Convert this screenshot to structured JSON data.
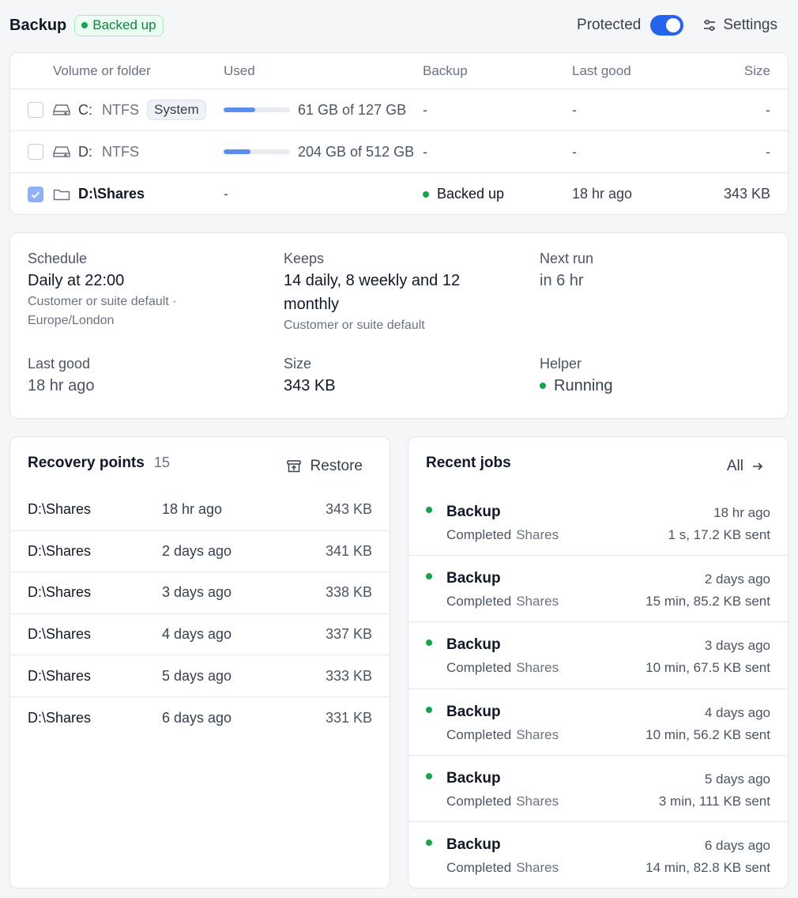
{
  "header": {
    "title": "Backup",
    "status_badge": "Backed up",
    "protected_label": "Protected",
    "protected_on": true,
    "settings_label": "Settings"
  },
  "volumes": {
    "columns": [
      "Volume or folder",
      "Used",
      "Backup",
      "Last good",
      "Size"
    ],
    "rows": [
      {
        "checked": false,
        "icon": "drive-icon",
        "name": "C:",
        "fs": "NTFS",
        "tag": "System",
        "used_fraction": 0.48,
        "used": "61 GB of 127 GB",
        "backup": "-",
        "last_good": "-",
        "size": "-"
      },
      {
        "checked": false,
        "icon": "drive-icon",
        "name": "D:",
        "fs": "NTFS",
        "tag": "",
        "used_fraction": 0.4,
        "used": "204 GB of 512 GB",
        "backup": "-",
        "last_good": "-",
        "size": "-"
      },
      {
        "checked": true,
        "icon": "folder-icon",
        "name": "D:\\Shares",
        "fs": "",
        "tag": "",
        "used_fraction": null,
        "used": "-",
        "backup": "Backed up",
        "last_good": "18 hr ago",
        "size": "343 KB"
      }
    ]
  },
  "summary": {
    "schedule": {
      "label": "Schedule",
      "value": "Daily at 22:00",
      "sub": "Customer or suite default · Europe/London"
    },
    "keeps": {
      "label": "Keeps",
      "value": "14 daily, 8 weekly and 12 monthly",
      "sub": "Customer or suite default"
    },
    "next_run": {
      "label": "Next run",
      "value": "in 6 hr"
    },
    "last_good": {
      "label": "Last good",
      "value": "18 hr ago"
    },
    "size": {
      "label": "Size",
      "value": "343 KB"
    },
    "helper": {
      "label": "Helper",
      "value": "Running"
    }
  },
  "recovery": {
    "title": "Recovery points",
    "count": "15",
    "restore_label": "Restore",
    "rows": [
      {
        "name": "D:\\Shares",
        "time": "18 hr ago",
        "size": "343 KB"
      },
      {
        "name": "D:\\Shares",
        "time": "2 days ago",
        "size": "341 KB"
      },
      {
        "name": "D:\\Shares",
        "time": "3 days ago",
        "size": "338 KB"
      },
      {
        "name": "D:\\Shares",
        "time": "4 days ago",
        "size": "337 KB"
      },
      {
        "name": "D:\\Shares",
        "time": "5 days ago",
        "size": "333 KB"
      },
      {
        "name": "D:\\Shares",
        "time": "6 days ago",
        "size": "331 KB"
      }
    ]
  },
  "jobs": {
    "title": "Recent jobs",
    "all_label": "All",
    "rows": [
      {
        "title": "Backup",
        "status": "Completed",
        "target": "Shares",
        "time": "18 hr ago",
        "detail": "1 s, 17.2 KB sent"
      },
      {
        "title": "Backup",
        "status": "Completed",
        "target": "Shares",
        "time": "2 days ago",
        "detail": "15 min, 85.2 KB sent"
      },
      {
        "title": "Backup",
        "status": "Completed",
        "target": "Shares",
        "time": "3 days ago",
        "detail": "10 min, 67.5 KB sent"
      },
      {
        "title": "Backup",
        "status": "Completed",
        "target": "Shares",
        "time": "4 days ago",
        "detail": "10 min, 56.2 KB sent"
      },
      {
        "title": "Backup",
        "status": "Completed",
        "target": "Shares",
        "time": "5 days ago",
        "detail": "3 min, 111 KB sent"
      },
      {
        "title": "Backup",
        "status": "Completed",
        "target": "Shares",
        "time": "6 days ago",
        "detail": "14 min, 82.8 KB sent"
      }
    ]
  },
  "colors": {
    "accent": "#2563eb",
    "success": "#16a34a",
    "bar": "#5b8def"
  }
}
